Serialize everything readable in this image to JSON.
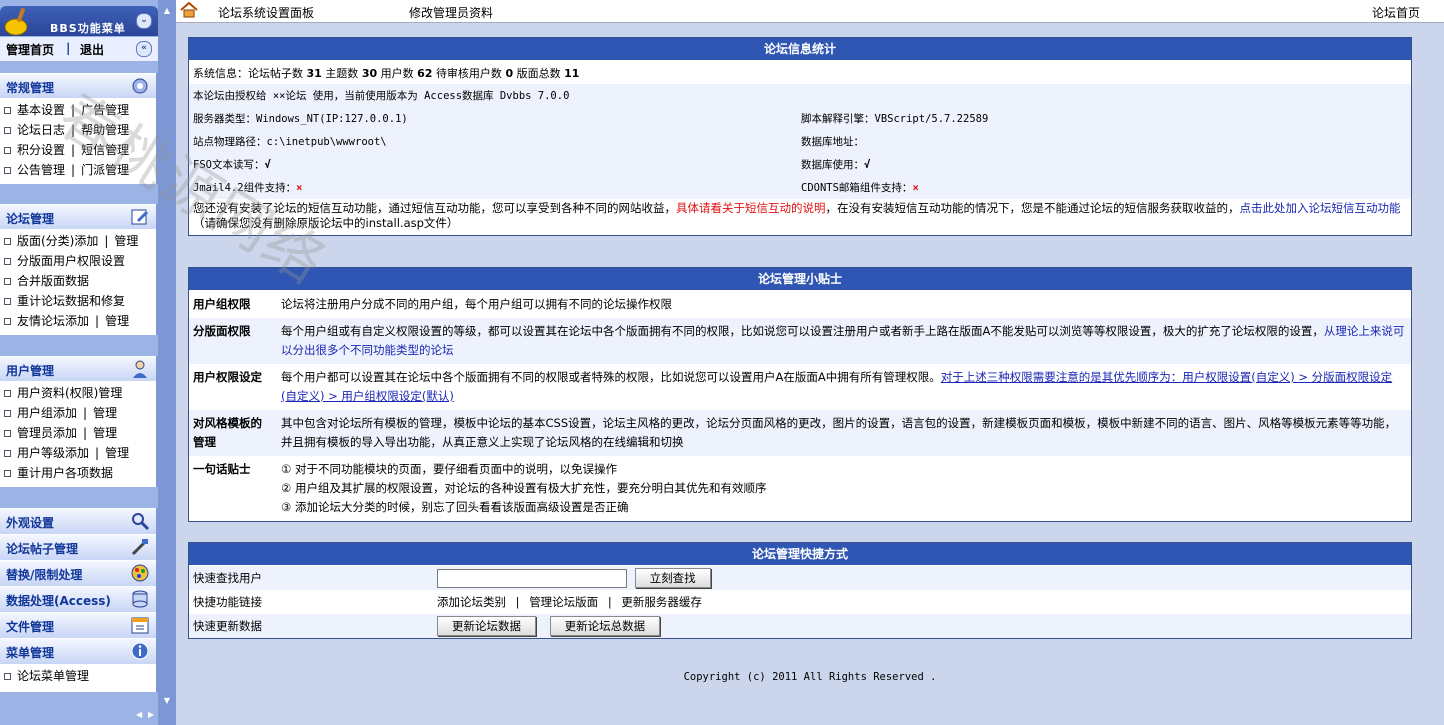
{
  "menu": {
    "title": "BBS功能菜单",
    "home": "管理首页",
    "divider": "|",
    "logout": "退出"
  },
  "sections": [
    {
      "title": "常规管理",
      "icon": "settings-icon",
      "items": [
        [
          "基本设置",
          "广告管理"
        ],
        [
          "论坛日志",
          "帮助管理"
        ],
        [
          "积分设置",
          "短信管理"
        ],
        [
          "公告管理",
          "门派管理"
        ]
      ]
    },
    {
      "title": "论坛管理",
      "icon": "edit-icon",
      "items": [
        [
          "版面(分类)添加",
          "管理"
        ],
        [
          "分版面用户权限设置"
        ],
        [
          "合并版面数据"
        ],
        [
          "重计论坛数据和修复"
        ],
        [
          "友情论坛添加",
          "管理"
        ]
      ]
    },
    {
      "title": "用户管理",
      "icon": "user-icon",
      "items": [
        [
          "用户资料(权限)管理"
        ],
        [
          "用户组添加",
          "管理"
        ],
        [
          "管理员添加",
          "管理"
        ],
        [
          "用户等级添加",
          "管理"
        ],
        [
          "重计用户各项数据"
        ]
      ]
    }
  ],
  "collapsed_sections": [
    {
      "title": "外观设置",
      "icon": "magnifier-icon"
    },
    {
      "title": "论坛帖子管理",
      "icon": "tools-icon"
    },
    {
      "title": "替换/限制处理",
      "icon": "palette-icon"
    },
    {
      "title": "数据处理(Access)",
      "icon": "database-icon"
    },
    {
      "title": "文件管理",
      "icon": "calendar-icon"
    },
    {
      "title": "菜单管理",
      "icon": "info-icon"
    }
  ],
  "menu_manage_item": "论坛菜单管理",
  "topbar": {
    "link1": "论坛系统设置面板",
    "link2": "修改管理员资料",
    "link3": "论坛首页"
  },
  "stats": {
    "title": "论坛信息统计",
    "sysinfo_label": "系统信息：",
    "posts_label": "论坛帖子数",
    "posts": "31",
    "topics_label": "主题数",
    "topics": "30",
    "users_label": "用户数",
    "users": "62",
    "pending_label": "待审核用户数",
    "pending": "0",
    "boards_label": "版面总数",
    "boards": "11",
    "license": "本论坛由授权给 ××论坛 使用，当前使用版本为 Access数据库 Dvbbs 7.0.0",
    "server_type": "服务器类型：Windows_NT(IP:127.0.0.1)",
    "script_engine": "脚本解释引擎：VBScript/5.7.22589",
    "site_path": "站点物理路径：c:\\inetpub\\wwwroot\\",
    "db_address": "数据库地址：",
    "fso": "FSO文本读写：",
    "fso_mark": "√",
    "db_use": "数据库使用：",
    "db_use_mark": "√",
    "jmail": "Jmail4.2组件支持：",
    "jmail_mark": "×",
    "cdonts": "CDONTS邮箱组件支持：",
    "cdonts_mark": "×",
    "sms_text1": "您还没有安装了论坛的短信互动功能，通过短信互动功能，您可以享受到各种不同的网站收益，",
    "sms_link1": "具体请看关于短信互动的说明",
    "sms_text2": "，在没有安装短信互动功能的情况下，您是不能通过论坛的短信服务获取收益的，",
    "sms_link2": "点击此处加入论坛短信互动功能",
    "sms_text3": "（请确保您没有删除原版论坛中的install.asp文件）"
  },
  "tips": {
    "title": "论坛管理小贴士",
    "rows": [
      {
        "label": "用户组权限",
        "text": "论坛将注册用户分成不同的用户组，每个用户组可以拥有不同的论坛操作权限",
        "link": ""
      },
      {
        "label": "分版面权限",
        "text": "每个用户组或有自定义权限设置的等级，都可以设置其在论坛中各个版面拥有不同的权限，比如说您可以设置注册用户或者新手上路在版面A不能发贴可以浏览等等权限设置，极大的扩充了论坛权限的设置，",
        "link": "从理论上来说可以分出很多个不同功能类型的论坛"
      },
      {
        "label": "用户权限设定",
        "text": "每个用户都可以设置其在论坛中各个版面拥有不同的权限或者特殊的权限，比如说您可以设置用户A在版面A中拥有所有管理权限。",
        "link": "对于上述三种权限需要注意的是其优先顺序为：用户权限设置(自定义) > 分版面权限设定(自定义) > 用户组权限设定(默认)"
      },
      {
        "label": "对风格模板的管理",
        "text": "其中包含对论坛所有模板的管理，模板中论坛的基本CSS设置，论坛主风格的更改，论坛分页面风格的更改，图片的设置，语言包的设置，新建模板页面和模板，模板中新建不同的语言、图片、风格等模板元素等等功能，并且拥有模板的导入导出功能，从真正意义上实现了论坛风格的在线编辑和切换",
        "link": ""
      }
    ],
    "oneline_label": "一句话贴士",
    "oneline": [
      "① 对于不同功能模块的页面，要仔细看页面中的说明，以免误操作",
      "② 用户组及其扩展的权限设置，对论坛的各种设置有极大扩充性，要充分明白其优先和有效顺序",
      "③ 添加论坛大分类的时候，别忘了回头看看该版面高级设置是否正确"
    ]
  },
  "quick": {
    "title": "论坛管理快捷方式",
    "search_label": "快速查找用户",
    "search_value": "",
    "search_button": "立刻查找",
    "links_label": "快捷功能链接",
    "link_add_category": "添加论坛类别",
    "link_manage_boards": "管理论坛版面",
    "link_refresh_cache": "更新服务器缓存",
    "update_label": "快速更新数据",
    "update_button": "更新论坛数据",
    "update_total_button": "更新论坛总数据"
  },
  "footer": "Copyright (c) 2011 All Rights Reserved .",
  "watermark": "春桃源网络"
}
